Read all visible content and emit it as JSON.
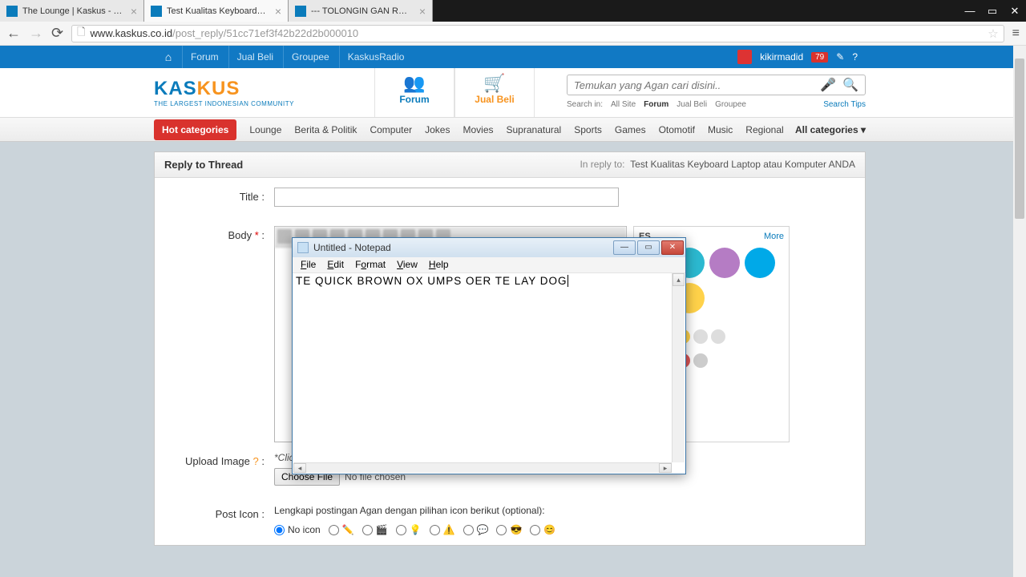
{
  "browser": {
    "tabs": [
      {
        "title": "The Lounge | Kaskus - The"
      },
      {
        "title": "Test Kualitas Keyboard La"
      },
      {
        "title": "--- TOLONGIN GAN RUM"
      }
    ],
    "url_host": "www.kaskus.co.id",
    "url_path": "/post_reply/51cc71ef3f42b22d2b000010"
  },
  "topbar": {
    "links": [
      "Forum",
      "Jual Beli",
      "Groupee",
      "KaskusRadio"
    ],
    "username": "kikirmadid",
    "badge": "79"
  },
  "logo": {
    "brand1": "KAS",
    "brand2": "KUS",
    "sub": "THE LARGEST INDONESIAN COMMUNITY"
  },
  "bigtabs": {
    "forum": "Forum",
    "jualbeli": "Jual Beli"
  },
  "search": {
    "placeholder": "Temukan yang Agan cari disini..",
    "label_searchin": "Search in:",
    "opts": [
      "All Site",
      "Forum",
      "Jual Beli",
      "Groupee"
    ],
    "tips": "Search Tips"
  },
  "cats": {
    "hot": "Hot categories",
    "list": [
      "Lounge",
      "Berita & Politik",
      "Computer",
      "Jokes",
      "Movies",
      "Supranatural",
      "Sports",
      "Games",
      "Otomotif",
      "Music",
      "Regional"
    ],
    "all": "All categories"
  },
  "panel": {
    "title": "Reply to Thread",
    "in_reply_to_label": "In reply to:",
    "in_reply_to": "Test Kualitas Keyboard Laptop atau Komputer ANDA"
  },
  "form": {
    "title_label": "Title  :",
    "body_label": "Body",
    "upload_label": "Upload Image",
    "upload_hint": "*Click thumbnail image to add to post content",
    "choose_file": "Choose File",
    "no_file": "No file chosen",
    "posticon_label": "Post Icon  :",
    "posticon_hint": "Lengkapi postingan Agan dengan pilihan icon berikut (optional):",
    "no_icon": "No icon"
  },
  "smilies": {
    "title": "ES",
    "more": "More"
  },
  "notepad": {
    "title": "Untitled - Notepad",
    "menus": [
      "File",
      "Edit",
      "Format",
      "View",
      "Help"
    ],
    "text": "TE QUICK BROWN OX UMPS OER TE LAY DOG"
  }
}
